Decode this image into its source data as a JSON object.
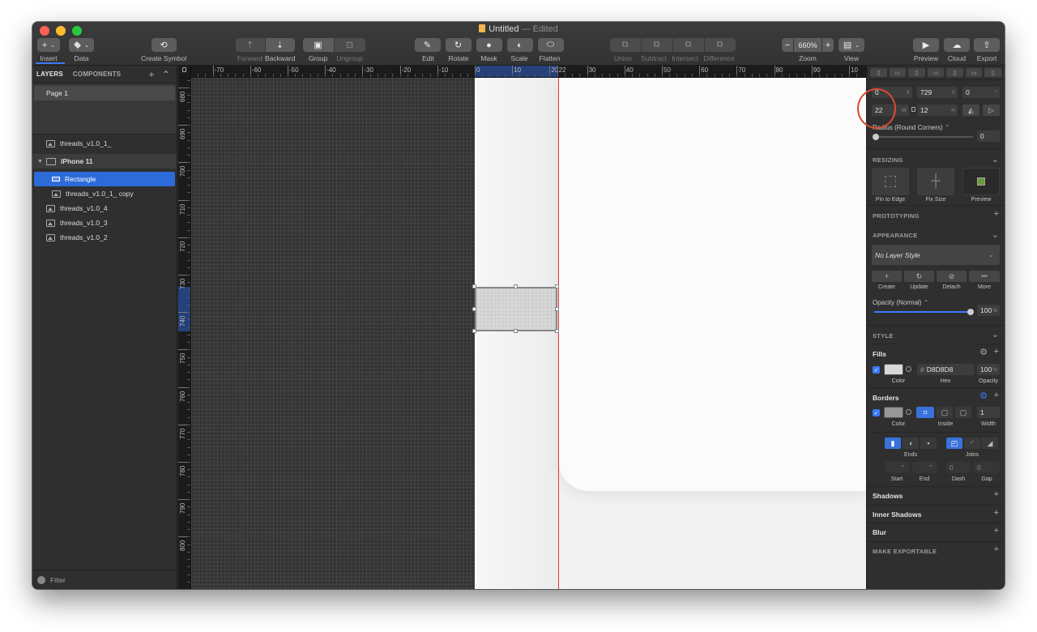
{
  "window": {
    "title": "Untitled",
    "status": "— Edited",
    "traffic_colors": [
      "#fe5f57",
      "#febc2e",
      "#28c840"
    ]
  },
  "toolbar": {
    "insert": {
      "label": "Insert",
      "glyph": "+"
    },
    "data": {
      "label": "Data"
    },
    "create_symbol": {
      "label": "Create Symbol"
    },
    "forward": {
      "label": "Forward"
    },
    "backward": {
      "label": "Backward"
    },
    "group": {
      "label": "Group"
    },
    "ungroup": {
      "label": "Ungroup"
    },
    "edit": {
      "label": "Edit"
    },
    "rotate": {
      "label": "Rotate"
    },
    "mask": {
      "label": "Mask"
    },
    "scale": {
      "label": "Scale"
    },
    "flatten": {
      "label": "Flatten"
    },
    "union": {
      "label": "Union"
    },
    "subtract": {
      "label": "Subtract"
    },
    "intersect": {
      "label": "Intersect"
    },
    "difference": {
      "label": "Difference"
    },
    "zoom": {
      "label": "Zoom",
      "value": "660%",
      "minus": "−",
      "plus": "+"
    },
    "view": {
      "label": "View"
    },
    "preview": {
      "label": "Preview"
    },
    "cloud": {
      "label": "Cloud"
    },
    "export": {
      "label": "Export"
    }
  },
  "layers_panel": {
    "tab_layers": "LAYERS",
    "tab_components": "COMPONENTS",
    "add_glyph": "+",
    "collapse_glyph": "⌃",
    "pages": [
      {
        "name": "Page 1"
      }
    ],
    "layers": [
      {
        "name": "threads_v1.0_1_",
        "type": "image"
      },
      {
        "name": "iPhone 11",
        "type": "artboard"
      },
      {
        "name": "Rectangle",
        "type": "rectangle",
        "selected": true
      },
      {
        "name": "threads_v1.0_1_ copy",
        "type": "image"
      },
      {
        "name": "threads_v1.0_4",
        "type": "image"
      },
      {
        "name": "threads_v1.0_3",
        "type": "image"
      },
      {
        "name": "threads_v1.0_2",
        "type": "image"
      }
    ],
    "filter_label": "Filter"
  },
  "rulers": {
    "h_labels": [
      "-70",
      "-60",
      "-50",
      "-40",
      "-30",
      "-20",
      "-10",
      "0",
      "10",
      "20",
      "22",
      "30",
      "40",
      "50",
      "60",
      "70",
      "80",
      "90",
      "10"
    ],
    "v_labels": [
      "680",
      "690",
      "700",
      "710",
      "720",
      "730",
      "740",
      "750",
      "760",
      "770",
      "780",
      "790",
      "800"
    ]
  },
  "inspector": {
    "x": {
      "value": "0",
      "unit": "X"
    },
    "y": {
      "value": "729",
      "unit": "Y"
    },
    "rotation": {
      "value": "0",
      "unit": "°"
    },
    "width": {
      "value": "22",
      "unit": "W"
    },
    "height": {
      "value": "12",
      "unit": "H"
    },
    "radius_label": "Radius (Round Corners)",
    "radius_value": "0",
    "resizing": {
      "title": "RESIZING",
      "pin_to_edge": "Pin to Edge",
      "fix_size": "Fix Size",
      "preview": "Preview"
    },
    "prototyping_title": "PROTOTYPING",
    "appearance": {
      "title": "APPEARANCE",
      "layer_style": "No Layer Style",
      "create": "Create",
      "update": "Update",
      "detach": "Detach",
      "more": "More",
      "more_glyph": "•••",
      "opacity_label": "Opacity (Normal)",
      "opacity_value": "100",
      "opacity_percent": 100
    },
    "style_title": "STYLE",
    "fills": {
      "title": "Fills",
      "hex": "D8D8D8",
      "hash": "#",
      "opacity": "100",
      "color_label": "Color",
      "hex_label": "Hex",
      "opacity_label": "Opacity",
      "swatch_color": "#d8d8d8"
    },
    "borders": {
      "title": "Borders",
      "position_label": "Inside",
      "width": "1",
      "color_label": "Color",
      "width_label": "Width",
      "ends_label": "Ends",
      "joins_label": "Joins",
      "start_label": "Start",
      "end_label": "End",
      "dash_label": "Dash",
      "gap_label": "Gap",
      "dash": "0",
      "gap": "0",
      "swatch_color": "#979797"
    },
    "shadows": "Shadows",
    "inner_shadows": "Inner Shadows",
    "blur": "Blur",
    "make_exportable": "MAKE EXPORTABLE",
    "plus_glyph": "+",
    "chevron_glyph": "⌄"
  },
  "colors": {
    "accent": "#3a7afe",
    "selection": "#2d6bd8",
    "annotation": "#d84a33",
    "guide": "#e53a3a"
  }
}
